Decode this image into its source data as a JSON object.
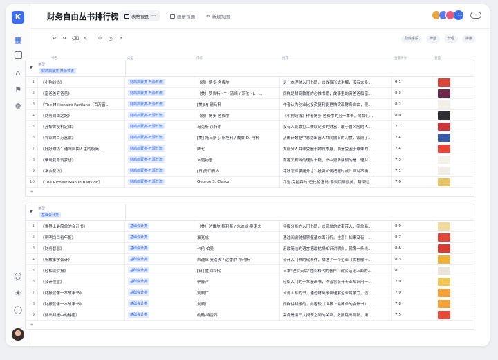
{
  "app": {
    "title": "财务自由丛书排行榜",
    "views": [
      {
        "label": "表格视图",
        "active": true
      },
      {
        "label": "画册视图",
        "active": false
      },
      {
        "label": "新建视图",
        "active": false
      }
    ],
    "more_label": "···",
    "collaborators_count": "+11"
  },
  "toolbar": {
    "pills": [
      "隐藏字段",
      "筛选",
      "分组",
      "排序"
    ]
  },
  "columns": {
    "name": "书名",
    "type": "类型",
    "author": "作者",
    "desc": "推荐",
    "score": "豆瓣评分",
    "cover": "封面"
  },
  "groups": [
    {
      "group_label": "类型",
      "tag": "财商启蒙类-开源节流",
      "rows": [
        {
          "num": "1",
          "name": "《小狗钱钱》",
          "type": "财商启蒙类-开源节流",
          "author": "（德）博多·舍费尔",
          "desc": "是一本理财入门书籍，以故事形式讲解，没有大多...",
          "score": "9.1",
          "cover_color": "#d9453b"
        },
        {
          "num": "2",
          "name": "《富爸爸穷爸爸》",
          "type": "财商启蒙类-开源节流",
          "author": "（美）罗伯特 · T · 清崎 / 莎伦 · L · ...",
          "desc": "同样是财商教育的必推书籍，故事里的穷爸爸和富...",
          "score": "8.3",
          "cover_color": "#6b2a4a"
        },
        {
          "num": "3",
          "name": "《The Millionaire Fastlane（百万富...",
          "type": "财商启蒙类-开源节流",
          "author": "[美]MJ·德马科",
          "desc": "作者认为创业比投资复利能更快实现财务自由，很...",
          "score": "8.2",
          "cover_color": "#f2efe6"
        },
        {
          "num": "4",
          "name": "《财务自由之路》",
          "type": "财商启蒙类-开源节流",
          "author": "（德）博多·舍费尔",
          "desc": "《小狗钱钱》作者博多·舍费尔的另一本书，向我们...",
          "score": "8.0",
          "cover_color": "#2f2f33"
        },
        {
          "num": "5",
          "name": "《苏黎世投机定律》",
          "type": "财商启蒙类-开源节流",
          "author": "马克斯·京特尔",
          "desc": "没有人能靠打工赚取足够的财富，敢于冒风险的人...",
          "score": "7.7",
          "cover_color": "#c8353a"
        },
        {
          "num": "6",
          "name": "《邻家的百万富翁》",
          "type": "财商启蒙类-开源节流",
          "author": "[美] 托马斯·J. 斯坦利 / 威廉·D. 丹科",
          "desc": "从统计数据中总结出富人共同拥有的习惯，饭前了...",
          "score": "7.4",
          "cover_color": "#3a5aa8"
        },
        {
          "num": "7",
          "name": "《好好赚钱：通向自由人生的极简...",
          "type": "财商启蒙类-开源节流",
          "author": "陆七",
          "desc": "大部分人并非受困于物质本身，而是受困于悬殊的...",
          "score": "7.4",
          "cover_color": "#e8443a"
        },
        {
          "num": "8",
          "name": "《谁说我身没梦想》",
          "type": "财商启蒙类-开源节流",
          "author": "水湄物语",
          "desc": "有趣又有料的理财书籍，书中更多强调的是：理财...",
          "score": "7.3",
          "cover_color": "#f4f1ea"
        },
        {
          "num": "9",
          "name": "《学会花钱》",
          "type": "财商启蒙类-开源节流",
          "author": "[日]野口真人",
          "desc": "花钱怎样掌握分寸？投资如何把握时点？面对不确...",
          "score": "7.1",
          "cover_color": "#f0ede6"
        },
        {
          "num": "10",
          "name": "《The Richest Man in Babylon》",
          "type": "财商启蒙类-开源节流",
          "author": "George S. Clason",
          "desc": "乔治·克拉森的\"巴比伦富翁\"系列风靡欧美，翻译过...",
          "score": "7.0",
          "cover_color": "#e5c46a"
        }
      ]
    },
    {
      "group_label": "类型",
      "tag": "基础会计类",
      "rows": [
        {
          "num": "1",
          "name": "《世界上最简单的会计书》",
          "type": "基础会计类",
          "author": "（美）达雷尔·穆利斯 / 朱迪丝·奥洛夫",
          "desc": "年报分析的入门书籍，以简单的故事带入，简单易...",
          "score": "8.9",
          "cover_color": "#f2d9a0"
        },
        {
          "num": "2",
          "name": "《明明白白看年报》",
          "type": "基础会计类",
          "author": "袁克成",
          "desc": "通过阅读财报掌握基本面分析。注意！如果没有一...",
          "score": "8.7",
          "cover_color": "#e0463a"
        },
        {
          "num": "3",
          "name": "《财务智慧》",
          "type": "基础会计类",
          "author": "卡伦·伯曼",
          "desc": "用最简洁的语言把最枯燥知识讲明白，就像一条线...",
          "score": "8.6",
          "cover_color": "#d83c30"
        },
        {
          "num": "4",
          "name": "《听故事学会计》",
          "type": "基础会计类",
          "author": "朱迪丝·奥洛夫 / 达雷尔·穆利斯",
          "desc": "会计入门书的代表作，描述了一个企业（卖柠檬汁...",
          "score": "8.3",
          "cover_color": "#f1b23a"
        },
        {
          "num": "5",
          "name": "《轻松读财报》",
          "type": "基础会计类",
          "author": "[日] 胜间和代",
          "desc": "日本\"理财天后\"胜间和代的著作，说实话比上面的...",
          "score": "8.1",
          "cover_color": "#e8e4da"
        },
        {
          "num": "6",
          "name": "《会计拉宣》",
          "type": "基础会计类",
          "author": "伊藤洋",
          "desc": "轻松入门的一本漫画书，作者将会计专业知识用一...",
          "score": "7.9",
          "cover_color": "#f0c85a"
        },
        {
          "num": "7",
          "name": "《财报就像一本故事书》",
          "type": "基础会计类",
          "author": "刘顺仁",
          "desc": "台湾人写的书，通过财务报表理解企业竞争力，适...",
          "score": "7.9",
          "cover_color": "#f2a23a"
        },
        {
          "num": "8",
          "name": "《财报就像一本故事书》",
          "type": "基础会计类",
          "author": "刘顺仁",
          "desc": "同样讲财报的，内容较《世界上最简单的会计书》...",
          "score": "7.8",
          "cover_color": "#f2a23a"
        },
        {
          "num": "9",
          "name": "《熬出财报中的秘密》",
          "type": "基础会计类",
          "author": "约翰·特雷西",
          "desc": "亮点是讲三大报表之间的关系，数数跳出局部，用...",
          "score": "7.5",
          "cover_color": "#e84a3a"
        }
      ]
    }
  ],
  "add_row_label": "+"
}
